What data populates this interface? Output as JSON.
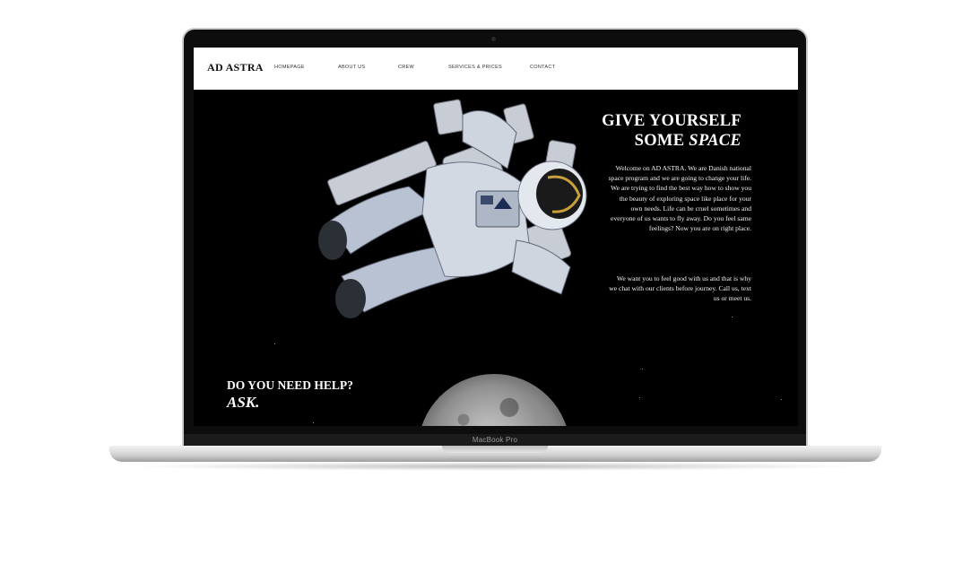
{
  "device": {
    "label": "MacBook Pro"
  },
  "site": {
    "brand": "AD ASTRA",
    "nav": [
      "HOMEPAGE",
      "ABOUT US",
      "CREW",
      "SERVICES & PRICES",
      "CONTACT"
    ],
    "hero": {
      "title_line1": "GIVE YOURSELF",
      "title_line2_prefix": "SOME ",
      "title_line2_italic": "SPACE",
      "paragraph1": "Welcome on AD ASTRA. We are Danish national space program and we are going to change your life. We are trying to find the best way how to show you the beauty of exploring space like place for your own needs. Life can be cruel sometimes and everyone of us wants to fly away. Do you feel same feelings? Now you are on right place.",
      "paragraph2": "We want you to feel good with us and that is why we chat with our clients before journey. Call us, text us or meet us."
    },
    "cta": {
      "line1": "DO YOU NEED HELP?",
      "line2": "ASK."
    }
  }
}
